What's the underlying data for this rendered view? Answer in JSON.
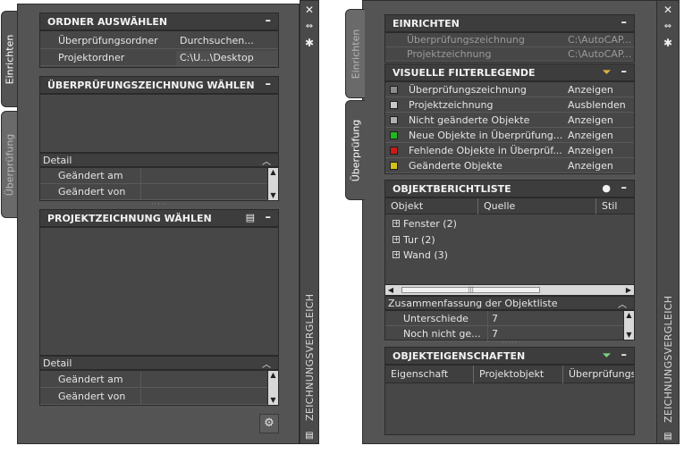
{
  "left": {
    "tabs": [
      "Einrichten",
      "Überprüfung"
    ],
    "palette_title": "ZEICHNUNGSVERGLEICH",
    "ordner": {
      "title": "ORDNER AUSWÄHLEN",
      "rows": [
        {
          "label": "Überprüfungsordner",
          "value": "Durchsuchen..."
        },
        {
          "label": "Projektordner",
          "value": "C:\\U...\\Desktop"
        }
      ]
    },
    "pruef": {
      "title": "ÜBERPRÜFUNGSZEICHNUNG WÄHLEN",
      "detail_label": "Detail",
      "rows": [
        "Geändert am",
        "Geändert von"
      ]
    },
    "projekt": {
      "title": "PROJEKTZEICHNUNG WÄHLEN",
      "detail_label": "Detail",
      "rows": [
        "Geändert am",
        "Geändert von"
      ]
    }
  },
  "right": {
    "tabs": [
      "Einrichten",
      "Überprüfung"
    ],
    "palette_title": "ZEICHNUNGSVERGLEICH",
    "einrichten": {
      "title": "EINRICHTEN",
      "rows": [
        {
          "label": "Überprüfungszeichnung",
          "value": "C:\\AutoCAP..."
        },
        {
          "label": "Projektzeichnung",
          "value": "C:\\AutoCAP..."
        }
      ]
    },
    "filter": {
      "title": "VISUELLE FILTERLEGENDE",
      "rows": [
        {
          "label": "Überprüfungszeichnung",
          "value": "Anzeigen",
          "color": "#8c8c8c"
        },
        {
          "label": "Projektzeichnung",
          "value": "Ausblenden",
          "color": "#c8c8c8"
        },
        {
          "label": "Nicht geänderte Objekte",
          "value": "Anzeigen",
          "color": "#b0b0b0"
        },
        {
          "label": "Neue Objekte in Überprüfung...",
          "value": "Anzeigen",
          "color": "#1fb81f"
        },
        {
          "label": "Fehlende Objekte in Überprüf...",
          "value": "Anzeigen",
          "color": "#cc1a1a"
        },
        {
          "label": "Geänderte Objekte",
          "value": "Anzeigen",
          "color": "#d4c21a"
        }
      ]
    },
    "bericht": {
      "title": "OBJEKTBERICHTLISTE",
      "columns": [
        "Objekt",
        "Quelle",
        "Stil"
      ],
      "items": [
        "Fenster (2)",
        "Tur (2)",
        "Wand (3)"
      ],
      "summary_label": "Zusammenfassung der Objektliste",
      "summary_rows": [
        {
          "label": "Unterschiede",
          "value": "7"
        },
        {
          "label": "Noch nicht ge...",
          "value": "7"
        }
      ]
    },
    "eigenschaften": {
      "title": "OBJEKTEIGENSCHAFTEN",
      "columns": [
        "Eigenschaft",
        "Projektobjekt",
        "Überprüfungs"
      ]
    }
  }
}
